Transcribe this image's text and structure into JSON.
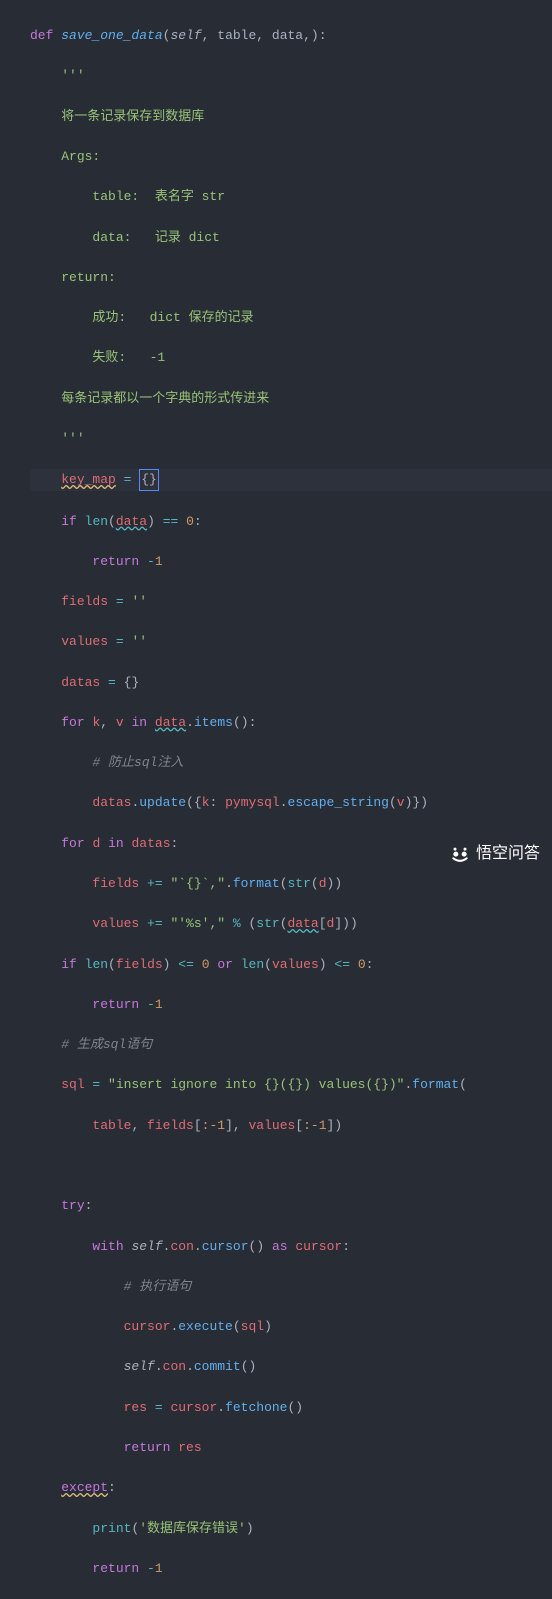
{
  "code": {
    "def": "def",
    "funcname": "save_one_data",
    "sig_open": "(",
    "self": "self",
    "comma": ", ",
    "p1": "table",
    "p2": "data",
    "sig_close": ",):",
    "doc_open": "'''",
    "doc_l1": "将一条记录保存到数据库",
    "doc_l2": "Args:",
    "doc_l3": "    table:  表名字 str",
    "doc_l4": "    data:   记录 dict",
    "doc_l5": "return:",
    "doc_l6": "    成功:   dict 保存的记录",
    "doc_l7": "    失败:   -1",
    "doc_l8": "每条记录都以一个字典的形式传进来",
    "doc_close": "'''",
    "key_map": "key_map",
    "eq": " = ",
    "cursor_braces": "{}",
    "if": "if",
    "len": "len",
    "data": "data",
    "eqeq": " == ",
    "zero": "0",
    "colon": ":",
    "return": "return",
    "neg1": "-1",
    "fields": "fields",
    "values": "values",
    "datas": "datas",
    "empty_str": "''",
    "empty_dict": "{}",
    "for": "for",
    "k": "k",
    "v": "v",
    "in": "in",
    "items": "items",
    "paren_open": "(",
    "paren_close": ")",
    "comment1": "# 防止sql注入",
    "update": "update",
    "brace_open": "{",
    "brace_close": "}",
    "pymysql": "pymysql",
    "dot": ".",
    "escape_string": "escape_string",
    "d": "d",
    "pluseq": " += ",
    "fmt_fields": "\"`{}`,\"",
    "format": "format",
    "str_fn": "str",
    "fmt_values": "\"'%s',\"",
    "pct": " % ",
    "bracket_open": "[",
    "bracket_close": "]",
    "le": " <= ",
    "or": "or",
    "comment2": "# 生成sql语句",
    "sql": "sql",
    "sql_str": "\"insert ignore into {}({}) values({})\"",
    "neg1_slice": ":-1",
    "try": "try",
    "with": "with",
    "con": "con",
    "cursor_fn": "cursor",
    "as": "as",
    "cursor_var": "cursor",
    "comment3": "# 执行语句",
    "execute": "execute",
    "commit": "commit",
    "res": "res",
    "fetchone": "fetchone",
    "except": "except",
    "print": "print",
    "err_msg": "'数据库保存错误'",
    "minus": "-",
    "one": "1"
  },
  "watermark": "悟空问答"
}
